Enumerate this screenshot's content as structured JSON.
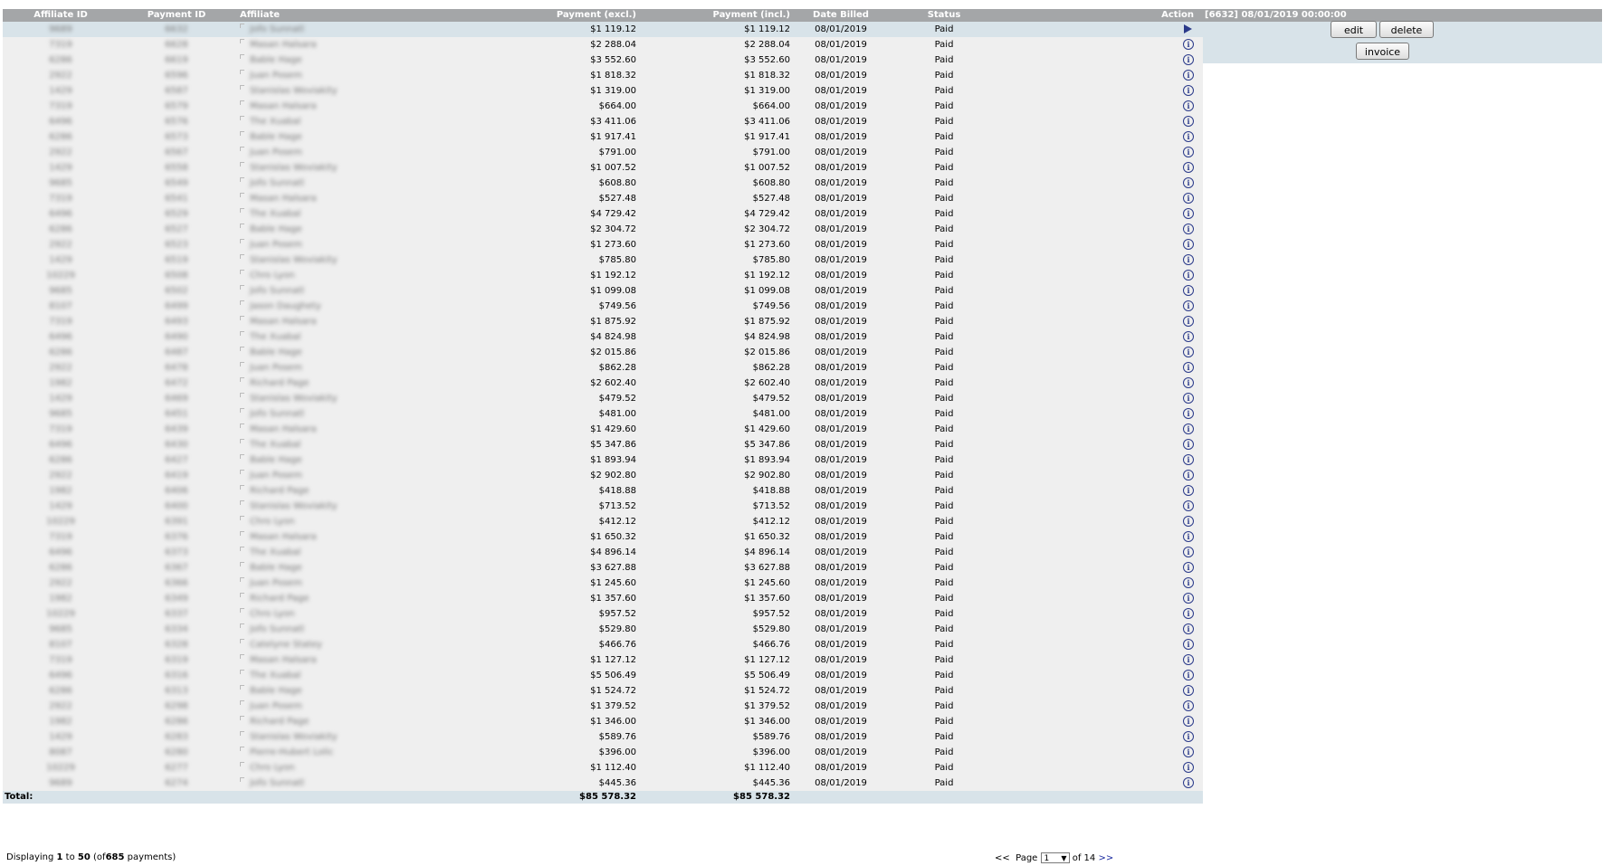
{
  "columns": {
    "affiliate_id": "Affiliate ID",
    "payment_id": "Payment ID",
    "affiliate": "Affiliate",
    "payment_excl": "Payment (excl.)",
    "payment_incl": "Payment (incl.)",
    "date_billed": "Date Billed",
    "status": "Status",
    "action": "Action"
  },
  "rows": [
    {
      "aff_id": "9689",
      "pay_id": "6632",
      "affiliate": "Jofo Sunnatl",
      "excl": "$1 119.12",
      "incl": "$1 119.12",
      "date": "08/01/2019",
      "status": "Paid"
    },
    {
      "aff_id": "7319",
      "pay_id": "6628",
      "affiliate": "Masan Halsara",
      "excl": "$2 288.04",
      "incl": "$2 288.04",
      "date": "08/01/2019",
      "status": "Paid"
    },
    {
      "aff_id": "6286",
      "pay_id": "6619",
      "affiliate": "Bable Hage",
      "excl": "$3 552.60",
      "incl": "$3 552.60",
      "date": "08/01/2019",
      "status": "Paid"
    },
    {
      "aff_id": "2922",
      "pay_id": "6596",
      "affiliate": "Juan Posem",
      "excl": "$1 818.32",
      "incl": "$1 818.32",
      "date": "08/01/2019",
      "status": "Paid"
    },
    {
      "aff_id": "1429",
      "pay_id": "6587",
      "affiliate": "Stanislas Woviakity",
      "excl": "$1 319.00",
      "incl": "$1 319.00",
      "date": "08/01/2019",
      "status": "Paid"
    },
    {
      "aff_id": "7319",
      "pay_id": "6579",
      "affiliate": "Masan Halsara",
      "excl": "$664.00",
      "incl": "$664.00",
      "date": "08/01/2019",
      "status": "Paid"
    },
    {
      "aff_id": "6496",
      "pay_id": "6576",
      "affiliate": "The Xuabal",
      "excl": "$3 411.06",
      "incl": "$3 411.06",
      "date": "08/01/2019",
      "status": "Paid"
    },
    {
      "aff_id": "6286",
      "pay_id": "6573",
      "affiliate": "Bable Hage",
      "excl": "$1 917.41",
      "incl": "$1 917.41",
      "date": "08/01/2019",
      "status": "Paid"
    },
    {
      "aff_id": "2922",
      "pay_id": "6567",
      "affiliate": "Juan Posem",
      "excl": "$791.00",
      "incl": "$791.00",
      "date": "08/01/2019",
      "status": "Paid"
    },
    {
      "aff_id": "1429",
      "pay_id": "6558",
      "affiliate": "Stanislas Woviakity",
      "excl": "$1 007.52",
      "incl": "$1 007.52",
      "date": "08/01/2019",
      "status": "Paid"
    },
    {
      "aff_id": "9685",
      "pay_id": "6549",
      "affiliate": "Jofo Sunnatl",
      "excl": "$608.80",
      "incl": "$608.80",
      "date": "08/01/2019",
      "status": "Paid"
    },
    {
      "aff_id": "7319",
      "pay_id": "6541",
      "affiliate": "Masan Halsara",
      "excl": "$527.48",
      "incl": "$527.48",
      "date": "08/01/2019",
      "status": "Paid"
    },
    {
      "aff_id": "6496",
      "pay_id": "6529",
      "affiliate": "The Xuabal",
      "excl": "$4 729.42",
      "incl": "$4 729.42",
      "date": "08/01/2019",
      "status": "Paid"
    },
    {
      "aff_id": "6286",
      "pay_id": "6527",
      "affiliate": "Bable Hage",
      "excl": "$2 304.72",
      "incl": "$2 304.72",
      "date": "08/01/2019",
      "status": "Paid"
    },
    {
      "aff_id": "2922",
      "pay_id": "6523",
      "affiliate": "Juan Posem",
      "excl": "$1 273.60",
      "incl": "$1 273.60",
      "date": "08/01/2019",
      "status": "Paid"
    },
    {
      "aff_id": "1429",
      "pay_id": "6519",
      "affiliate": "Stanislas Woviakity",
      "excl": "$785.80",
      "incl": "$785.80",
      "date": "08/01/2019",
      "status": "Paid"
    },
    {
      "aff_id": "10229",
      "pay_id": "6508",
      "affiliate": "Chro Lyon",
      "excl": "$1 192.12",
      "incl": "$1 192.12",
      "date": "08/01/2019",
      "status": "Paid"
    },
    {
      "aff_id": "9685",
      "pay_id": "6502",
      "affiliate": "Jofo Sunnatl",
      "excl": "$1 099.08",
      "incl": "$1 099.08",
      "date": "08/01/2019",
      "status": "Paid"
    },
    {
      "aff_id": "8107",
      "pay_id": "6499",
      "affiliate": "Jason Daughety",
      "excl": "$749.56",
      "incl": "$749.56",
      "date": "08/01/2019",
      "status": "Paid"
    },
    {
      "aff_id": "7319",
      "pay_id": "6493",
      "affiliate": "Masan Halsara",
      "excl": "$1 875.92",
      "incl": "$1 875.92",
      "date": "08/01/2019",
      "status": "Paid"
    },
    {
      "aff_id": "6496",
      "pay_id": "6490",
      "affiliate": "The Xuabal",
      "excl": "$4 824.98",
      "incl": "$4 824.98",
      "date": "08/01/2019",
      "status": "Paid"
    },
    {
      "aff_id": "6286",
      "pay_id": "6487",
      "affiliate": "Bable Hage",
      "excl": "$2 015.86",
      "incl": "$2 015.86",
      "date": "08/01/2019",
      "status": "Paid"
    },
    {
      "aff_id": "2922",
      "pay_id": "6478",
      "affiliate": "Juan Posem",
      "excl": "$862.28",
      "incl": "$862.28",
      "date": "08/01/2019",
      "status": "Paid"
    },
    {
      "aff_id": "1982",
      "pay_id": "6472",
      "affiliate": "Richard Page",
      "excl": "$2 602.40",
      "incl": "$2 602.40",
      "date": "08/01/2019",
      "status": "Paid"
    },
    {
      "aff_id": "1429",
      "pay_id": "6469",
      "affiliate": "Stanislas Woviakity",
      "excl": "$479.52",
      "incl": "$479.52",
      "date": "08/01/2019",
      "status": "Paid"
    },
    {
      "aff_id": "9685",
      "pay_id": "6451",
      "affiliate": "Jofo Sunnatl",
      "excl": "$481.00",
      "incl": "$481.00",
      "date": "08/01/2019",
      "status": "Paid"
    },
    {
      "aff_id": "7319",
      "pay_id": "6439",
      "affiliate": "Masan Halsara",
      "excl": "$1 429.60",
      "incl": "$1 429.60",
      "date": "08/01/2019",
      "status": "Paid"
    },
    {
      "aff_id": "6496",
      "pay_id": "6430",
      "affiliate": "The Xuabal",
      "excl": "$5 347.86",
      "incl": "$5 347.86",
      "date": "08/01/2019",
      "status": "Paid"
    },
    {
      "aff_id": "6286",
      "pay_id": "6427",
      "affiliate": "Bable Hage",
      "excl": "$1 893.94",
      "incl": "$1 893.94",
      "date": "08/01/2019",
      "status": "Paid"
    },
    {
      "aff_id": "2922",
      "pay_id": "6419",
      "affiliate": "Juan Posem",
      "excl": "$2 902.80",
      "incl": "$2 902.80",
      "date": "08/01/2019",
      "status": "Paid"
    },
    {
      "aff_id": "1982",
      "pay_id": "6406",
      "affiliate": "Richard Page",
      "excl": "$418.88",
      "incl": "$418.88",
      "date": "08/01/2019",
      "status": "Paid"
    },
    {
      "aff_id": "1429",
      "pay_id": "6400",
      "affiliate": "Stanislas Woviakity",
      "excl": "$713.52",
      "incl": "$713.52",
      "date": "08/01/2019",
      "status": "Paid"
    },
    {
      "aff_id": "10229",
      "pay_id": "6391",
      "affiliate": "Chro Lyon",
      "excl": "$412.12",
      "incl": "$412.12",
      "date": "08/01/2019",
      "status": "Paid"
    },
    {
      "aff_id": "7319",
      "pay_id": "6376",
      "affiliate": "Masan Halsara",
      "excl": "$1 650.32",
      "incl": "$1 650.32",
      "date": "08/01/2019",
      "status": "Paid"
    },
    {
      "aff_id": "6496",
      "pay_id": "6373",
      "affiliate": "The Xuabal",
      "excl": "$4 896.14",
      "incl": "$4 896.14",
      "date": "08/01/2019",
      "status": "Paid"
    },
    {
      "aff_id": "6286",
      "pay_id": "6367",
      "affiliate": "Bable Hage",
      "excl": "$3 627.88",
      "incl": "$3 627.88",
      "date": "08/01/2019",
      "status": "Paid"
    },
    {
      "aff_id": "2922",
      "pay_id": "6366",
      "affiliate": "Juan Posem",
      "excl": "$1 245.60",
      "incl": "$1 245.60",
      "date": "08/01/2019",
      "status": "Paid"
    },
    {
      "aff_id": "1982",
      "pay_id": "6349",
      "affiliate": "Richard Page",
      "excl": "$1 357.60",
      "incl": "$1 357.60",
      "date": "08/01/2019",
      "status": "Paid"
    },
    {
      "aff_id": "10229",
      "pay_id": "6337",
      "affiliate": "Chro Lyon",
      "excl": "$957.52",
      "incl": "$957.52",
      "date": "08/01/2019",
      "status": "Paid"
    },
    {
      "aff_id": "9685",
      "pay_id": "6334",
      "affiliate": "Jofo Sunnatl",
      "excl": "$529.80",
      "incl": "$529.80",
      "date": "08/01/2019",
      "status": "Paid"
    },
    {
      "aff_id": "8107",
      "pay_id": "6328",
      "affiliate": "Catelyne Statey",
      "excl": "$466.76",
      "incl": "$466.76",
      "date": "08/01/2019",
      "status": "Paid"
    },
    {
      "aff_id": "7319",
      "pay_id": "6319",
      "affiliate": "Masan Halsara",
      "excl": "$1 127.12",
      "incl": "$1 127.12",
      "date": "08/01/2019",
      "status": "Paid"
    },
    {
      "aff_id": "6496",
      "pay_id": "6316",
      "affiliate": "The Xuabal",
      "excl": "$5 506.49",
      "incl": "$5 506.49",
      "date": "08/01/2019",
      "status": "Paid"
    },
    {
      "aff_id": "6286",
      "pay_id": "6313",
      "affiliate": "Bable Hage",
      "excl": "$1 524.72",
      "incl": "$1 524.72",
      "date": "08/01/2019",
      "status": "Paid"
    },
    {
      "aff_id": "2922",
      "pay_id": "6298",
      "affiliate": "Juan Posem",
      "excl": "$1 379.52",
      "incl": "$1 379.52",
      "date": "08/01/2019",
      "status": "Paid"
    },
    {
      "aff_id": "1982",
      "pay_id": "6286",
      "affiliate": "Richard Page",
      "excl": "$1 346.00",
      "incl": "$1 346.00",
      "date": "08/01/2019",
      "status": "Paid"
    },
    {
      "aff_id": "1429",
      "pay_id": "6283",
      "affiliate": "Stanislas Woviakity",
      "excl": "$589.76",
      "incl": "$589.76",
      "date": "08/01/2019",
      "status": "Paid"
    },
    {
      "aff_id": "8087",
      "pay_id": "6280",
      "affiliate": "Pierre-Hubert Lolic",
      "excl": "$396.00",
      "incl": "$396.00",
      "date": "08/01/2019",
      "status": "Paid"
    },
    {
      "aff_id": "10229",
      "pay_id": "6277",
      "affiliate": "Chro Lyon",
      "excl": "$1 112.40",
      "incl": "$1 112.40",
      "date": "08/01/2019",
      "status": "Paid"
    },
    {
      "aff_id": "9689",
      "pay_id": "6274",
      "affiliate": "Jofo Sunnatl",
      "excl": "$445.36",
      "incl": "$445.36",
      "date": "08/01/2019",
      "status": "Paid"
    }
  ],
  "totals": {
    "label": "Total:",
    "excl": "$85 578.32",
    "incl": "$85 578.32"
  },
  "footer": {
    "displaying_prefix": "Displaying",
    "from": "1",
    "to_word": "to",
    "to": "50",
    "of_prefix": "(of",
    "total": "685",
    "suffix": "payments)"
  },
  "pager": {
    "prev": "<<",
    "page_label": "Page",
    "current_page": "1",
    "of_label": "of",
    "total_pages": "14",
    "next": ">>"
  },
  "detail": {
    "header": "[6632]  08/01/2019 00:00:00",
    "edit_label": "edit",
    "delete_label": "delete",
    "invoice_label": "invoice"
  },
  "icons": {
    "selected_row": "play-icon",
    "row_action": "info-icon"
  },
  "colors": {
    "header_bg": "#a4a6a8",
    "row_bg": "#efefef",
    "selected_bg": "#d8e3e9",
    "link": "#1a2aa0"
  }
}
